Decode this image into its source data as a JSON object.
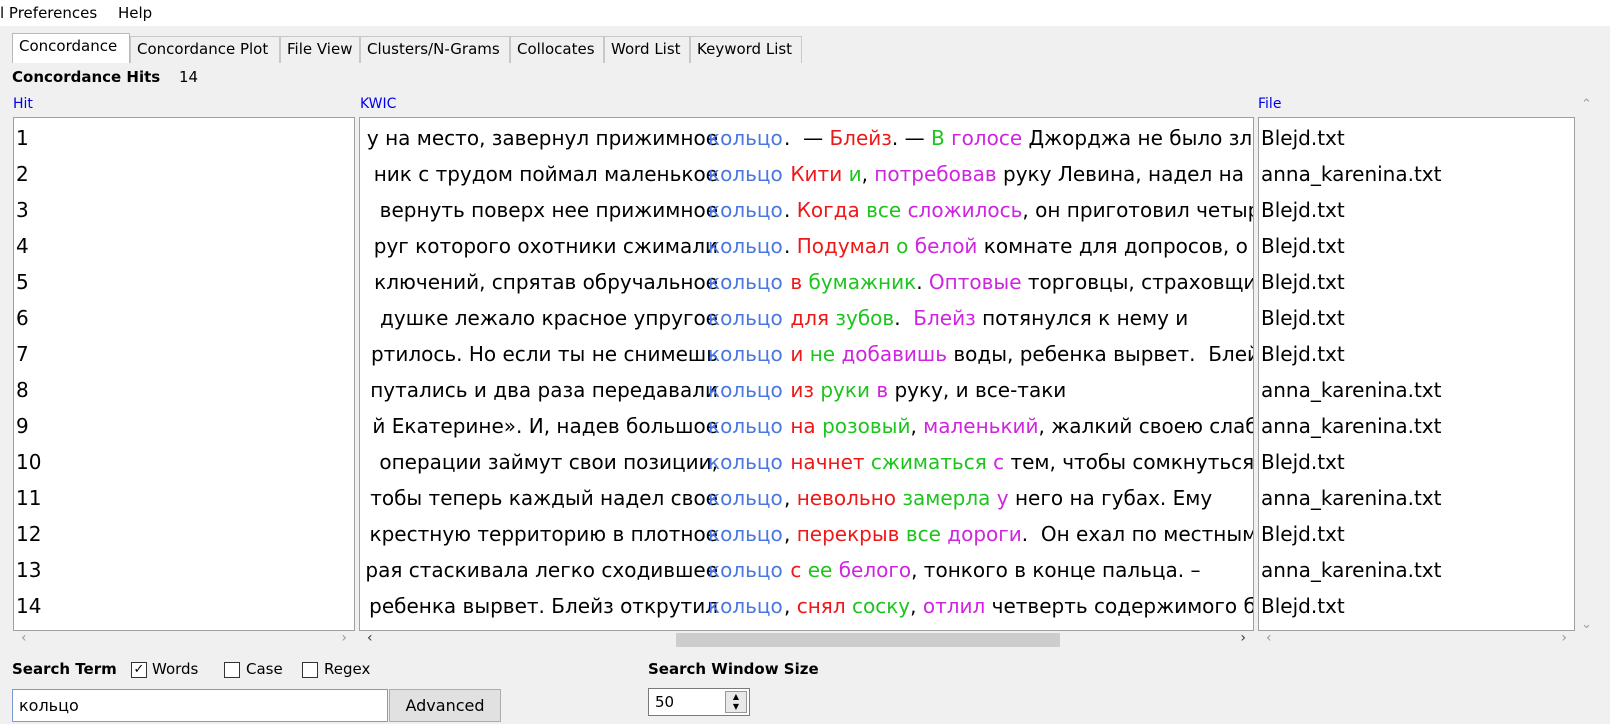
{
  "menu": {
    "preferences": "l Preferences",
    "help": "Help"
  },
  "tabs": [
    "Concordance",
    "Concordance Plot",
    "File View",
    "Clusters/N-Grams",
    "Collocates",
    "Word List",
    "Keyword List"
  ],
  "hits": {
    "label": "Concordance Hits",
    "count": "14"
  },
  "columns": {
    "hit": "Hit",
    "kwic": "KWIC",
    "file": "File"
  },
  "rows": [
    {
      "hit": "1",
      "left": "у на место, завернул прижимное",
      "node": "кольцо",
      "right": [
        [
          ".  — ",
          ""
        ],
        [
          "Блейз",
          "red"
        ],
        [
          ". — ",
          ""
        ],
        [
          "В",
          "green"
        ],
        [
          " ",
          ""
        ],
        [
          "голосе",
          "mag"
        ],
        [
          " Джорджа не было злости",
          ""
        ]
      ],
      "file": "Blejd.txt"
    },
    {
      "hit": "2",
      "left": "ник с трудом поймал маленькое",
      "node": "кольцо",
      "right": [
        [
          " ",
          ""
        ],
        [
          "Кити",
          "red"
        ],
        [
          " ",
          ""
        ],
        [
          "и",
          "green"
        ],
        [
          ", ",
          ""
        ],
        [
          "потребовав",
          "mag"
        ],
        [
          " руку Левина, надел на",
          ""
        ]
      ],
      "file": "anna_karenina.txt"
    },
    {
      "hit": "3",
      "left": "вернуть поверх нее прижимное",
      "node": "кольцо",
      "right": [
        [
          ". ",
          ""
        ],
        [
          "Когда",
          "red"
        ],
        [
          " ",
          ""
        ],
        [
          "все",
          "green"
        ],
        [
          " ",
          ""
        ],
        [
          "сложилось",
          "mag"
        ],
        [
          ", он приготовил четыре",
          ""
        ]
      ],
      "file": "Blejd.txt"
    },
    {
      "hit": "4",
      "left": "руг которого охотники сжимали",
      "node": "кольцо",
      "right": [
        [
          ". ",
          ""
        ],
        [
          "Подумал",
          "red"
        ],
        [
          " ",
          ""
        ],
        [
          "о",
          "green"
        ],
        [
          " ",
          ""
        ],
        [
          "белой",
          "mag"
        ],
        [
          " комнате для допросов, о",
          ""
        ]
      ],
      "file": "Blejd.txt"
    },
    {
      "hit": "5",
      "left": "ключений, спрятав обручальное",
      "node": "кольцо",
      "right": [
        [
          " ",
          ""
        ],
        [
          "в",
          "red"
        ],
        [
          " ",
          ""
        ],
        [
          "бумажник",
          "green"
        ],
        [
          ". ",
          ""
        ],
        [
          "Оптовые",
          "mag"
        ],
        [
          " торговцы, страховщики",
          ""
        ]
      ],
      "file": "Blejd.txt"
    },
    {
      "hit": "6",
      "left": "душке лежало красное упругое",
      "node": "кольцо",
      "right": [
        [
          " ",
          ""
        ],
        [
          "для",
          "red"
        ],
        [
          " ",
          ""
        ],
        [
          "зубов",
          "green"
        ],
        [
          ".  ",
          ""
        ],
        [
          "Блейз",
          "mag"
        ],
        [
          " потянулся к нему и",
          ""
        ]
      ],
      "file": "Blejd.txt"
    },
    {
      "hit": "7",
      "left": "ртилось. Но если ты не снимешь",
      "node": "кольцо",
      "right": [
        [
          " ",
          ""
        ],
        [
          "и",
          "red"
        ],
        [
          " ",
          ""
        ],
        [
          "не",
          "green"
        ],
        [
          " ",
          ""
        ],
        [
          "добавишь",
          "mag"
        ],
        [
          " воды, ребенка вырвет.  Блейз",
          ""
        ]
      ],
      "file": "Blejd.txt"
    },
    {
      "hit": "8",
      "left": "путались и два раза передавали",
      "node": "кольцо",
      "right": [
        [
          " ",
          ""
        ],
        [
          "из",
          "red"
        ],
        [
          " ",
          ""
        ],
        [
          "руки",
          "green"
        ],
        [
          " ",
          ""
        ],
        [
          "в",
          "mag"
        ],
        [
          " руку, и все-таки",
          ""
        ]
      ],
      "file": "anna_karenina.txt"
    },
    {
      "hit": "9",
      "left": "й Екатерине». И, надев большое",
      "node": "кольцо",
      "right": [
        [
          " ",
          ""
        ],
        [
          "на",
          "red"
        ],
        [
          " ",
          ""
        ],
        [
          "розовый",
          "green"
        ],
        [
          ", ",
          ""
        ],
        [
          "маленький",
          "mag"
        ],
        [
          ", жалкий своею слабостью",
          ""
        ]
      ],
      "file": "anna_karenina.txt"
    },
    {
      "hit": "10",
      "left": "операции займут свои позиции,",
      "node": "кольцо",
      "right": [
        [
          " ",
          ""
        ],
        [
          "начнет",
          "red"
        ],
        [
          " ",
          ""
        ],
        [
          "сжиматься",
          "green"
        ],
        [
          " ",
          ""
        ],
        [
          "с",
          "mag"
        ],
        [
          " тем, чтобы сомкнуться на",
          ""
        ]
      ],
      "file": "Blejd.txt"
    },
    {
      "hit": "11",
      "left": "тобы теперь каждый надел свое",
      "node": "кольцо",
      "right": [
        [
          ", ",
          ""
        ],
        [
          "невольно",
          "red"
        ],
        [
          " ",
          ""
        ],
        [
          "замерла",
          "green"
        ],
        [
          " ",
          ""
        ],
        [
          "у",
          "mag"
        ],
        [
          " него на губах. Ему",
          ""
        ]
      ],
      "file": "anna_karenina.txt"
    },
    {
      "hit": "12",
      "left": "крестную территорию в плотное",
      "node": "кольцо",
      "right": [
        [
          ", ",
          ""
        ],
        [
          "перекрыв",
          "red"
        ],
        [
          " ",
          ""
        ],
        [
          "все",
          "green"
        ],
        [
          " ",
          ""
        ],
        [
          "дороги",
          "mag"
        ],
        [
          ".  Он ехал по местным",
          ""
        ]
      ],
      "file": "Blejd.txt"
    },
    {
      "hit": "13",
      "left": "рая стаскивала легко сходившее",
      "node": "кольцо",
      "right": [
        [
          " ",
          ""
        ],
        [
          "с",
          "red"
        ],
        [
          " ",
          ""
        ],
        [
          "ее",
          "green"
        ],
        [
          " ",
          ""
        ],
        [
          "белого",
          "mag"
        ],
        [
          ", тонкого в конце пальца. –",
          ""
        ]
      ],
      "file": "anna_karenina.txt"
    },
    {
      "hit": "14",
      "left": "ребенка вырвет.  Блейз открутил",
      "node": "кольцо",
      "right": [
        [
          ", ",
          ""
        ],
        [
          "снял",
          "red"
        ],
        [
          " ",
          ""
        ],
        [
          "соску",
          "green"
        ],
        [
          ", ",
          ""
        ],
        [
          "отлил",
          "mag"
        ],
        [
          " четверть содержимого бутылки",
          ""
        ]
      ],
      "file": "Blejd.txt"
    }
  ],
  "search": {
    "label": "Search Term",
    "words_label": "Words",
    "words_checked": true,
    "case_label": "Case",
    "case_checked": false,
    "regex_label": "Regex",
    "regex_checked": false,
    "value": "кольцо",
    "advanced_label": "Advanced"
  },
  "window_size": {
    "label": "Search Window Size",
    "value": "50"
  },
  "colors": {
    "node": "#4a78e0",
    "red": "#ef1818",
    "green": "#1ec41e",
    "magenta": "#cf24e0",
    "header_link": "#0000ee"
  }
}
